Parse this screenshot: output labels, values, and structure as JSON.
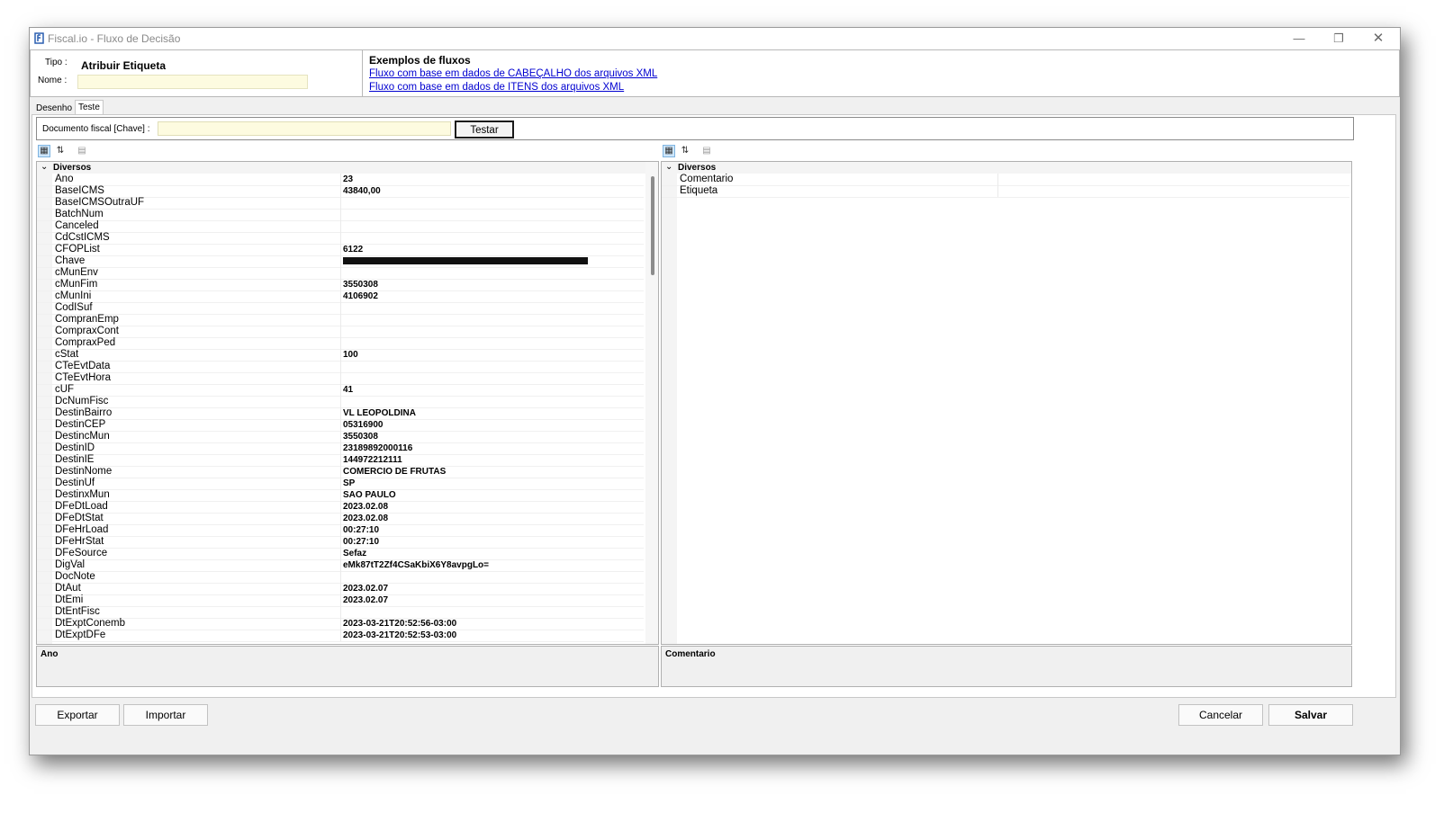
{
  "window": {
    "title": "Fiscal.io - Fluxo de Decisão",
    "minimize_glyph": "—",
    "restore_glyph": "❐",
    "close_glyph": "✕"
  },
  "header": {
    "tipo_label": "Tipo :",
    "tipo_value": "Atribuir Etiqueta",
    "nome_label": "Nome :",
    "nome_value": "",
    "examples_title": "Exemplos de fluxos",
    "example_links": [
      "Fluxo com base em dados de CABEÇALHO dos arquivos XML",
      "Fluxo com base em dados de ITENS dos arquivos XML"
    ]
  },
  "tabs": [
    "Desenho",
    "Teste"
  ],
  "document_bar": {
    "label": "Documento fiscal [Chave] :",
    "value": "",
    "test_button": "Testar"
  },
  "left_grid": {
    "category": "Diversos",
    "rows": [
      {
        "k": "Ano",
        "v": "23"
      },
      {
        "k": "BaseICMS",
        "v": "43840,00"
      },
      {
        "k": "BaseICMSOutraUF",
        "v": ""
      },
      {
        "k": "BatchNum",
        "v": ""
      },
      {
        "k": "Canceled",
        "v": ""
      },
      {
        "k": "CdCstICMS",
        "v": ""
      },
      {
        "k": "CFOPList",
        "v": "6122"
      },
      {
        "k": "Chave",
        "v": ""
      },
      {
        "k": "cMunEnv",
        "v": ""
      },
      {
        "k": "cMunFim",
        "v": "3550308"
      },
      {
        "k": "cMunIni",
        "v": "4106902"
      },
      {
        "k": "CodISuf",
        "v": ""
      },
      {
        "k": "CompranEmp",
        "v": ""
      },
      {
        "k": "ComprаxCont",
        "v": ""
      },
      {
        "k": "ComprаxPed",
        "v": ""
      },
      {
        "k": "cStat",
        "v": "100"
      },
      {
        "k": "CTeEvtData",
        "v": ""
      },
      {
        "k": "CTeEvtHora",
        "v": ""
      },
      {
        "k": "cUF",
        "v": "41"
      },
      {
        "k": "DcNumFisc",
        "v": ""
      },
      {
        "k": "DestinBairro",
        "v": "VL LEOPOLDINA"
      },
      {
        "k": "DestinCEP",
        "v": "05316900"
      },
      {
        "k": "DestincMun",
        "v": "3550308"
      },
      {
        "k": "DestinID",
        "v": "23189892000116"
      },
      {
        "k": "DestinIE",
        "v": "144972212111"
      },
      {
        "k": "DestinNome",
        "v": "COMERCIO DE FRUTAS"
      },
      {
        "k": "DestinUf",
        "v": "SP"
      },
      {
        "k": "DestinxMun",
        "v": "SAO PAULO"
      },
      {
        "k": "DFeDtLoad",
        "v": "2023.02.08"
      },
      {
        "k": "DFeDtStat",
        "v": "2023.02.08"
      },
      {
        "k": "DFeHrLoad",
        "v": "00:27:10"
      },
      {
        "k": "DFeHrStat",
        "v": "00:27:10"
      },
      {
        "k": "DFeSource",
        "v": "Sefaz"
      },
      {
        "k": "DigVal",
        "v": "eMk87tT2Zf4CSaKbiX6Y8avpgLo="
      },
      {
        "k": "DocNote",
        "v": ""
      },
      {
        "k": "DtAut",
        "v": "2023.02.07"
      },
      {
        "k": "DtEmi",
        "v": "2023.02.07"
      },
      {
        "k": "DtEntFisc",
        "v": ""
      },
      {
        "k": "DtExptConemb",
        "v": "2023-03-21T20:52:56-03:00"
      },
      {
        "k": "DtExptDFe",
        "v": "2023-03-21T20:52:53-03:00"
      }
    ],
    "description": "Ano"
  },
  "right_grid": {
    "category": "Diversos",
    "rows": [
      {
        "k": "Comentario",
        "v": ""
      },
      {
        "k": "Etiqueta",
        "v": ""
      }
    ],
    "description": "Comentario"
  },
  "toolbar_icons": [
    "categorized-icon",
    "alphabetical-sort-icon",
    "property-pages-icon"
  ],
  "footer": {
    "export_label": "Exportar",
    "import_label": "Importar",
    "cancel_label": "Cancelar",
    "save_label": "Salvar"
  },
  "colors": {
    "input_bg": "#fdfbe0",
    "link": "#0000d0",
    "window_bg": "#f0f0f0"
  }
}
